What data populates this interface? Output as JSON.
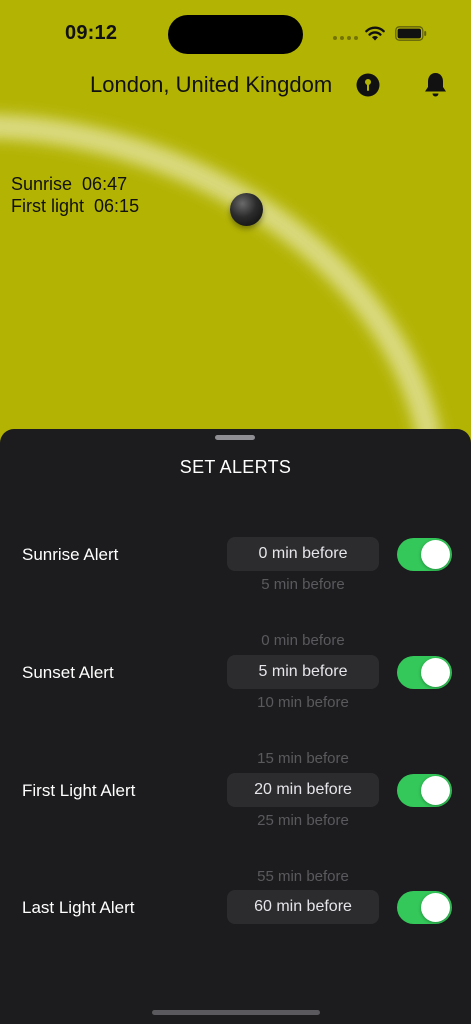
{
  "status_bar": {
    "time": "09:12"
  },
  "header": {
    "location": "London, United Kingdom",
    "icons": [
      "location-pin-icon",
      "bell-icon"
    ]
  },
  "sun": {
    "sunrise_label": "Sunrise",
    "sunrise_time": "06:47",
    "first_light_label": "First light",
    "first_light_time": "06:15"
  },
  "sheet": {
    "title": "SET ALERTS",
    "alerts": [
      {
        "label": "Sunrise Alert",
        "above": "",
        "selected": "0 min before",
        "below": "5 min before",
        "enabled": true
      },
      {
        "label": "Sunset Alert",
        "above": "0 min before",
        "selected": "5 min before",
        "below": "10 min before",
        "enabled": true
      },
      {
        "label": "First Light Alert",
        "above": "15 min before",
        "selected": "20 min before",
        "below": "25 min before",
        "enabled": true
      },
      {
        "label": "Last Light Alert",
        "above": "55 min before",
        "selected": "60 min before",
        "below": "",
        "enabled": true
      }
    ]
  },
  "colors": {
    "background": "#b3b304",
    "sheet": "#1c1c1e",
    "toggle_on": "#34c759"
  }
}
